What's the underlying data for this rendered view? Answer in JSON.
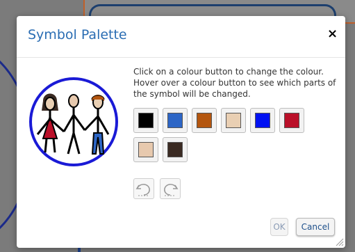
{
  "dialog": {
    "title": "Symbol Palette",
    "close_label": "×",
    "instructions": "Click on a colour button to change the colour. Hover over a colour button to see which parts of the symbol will be changed.",
    "ok_label": "OK",
    "cancel_label": "Cancel"
  },
  "colours": [
    {
      "name": "black",
      "hex": "#000000"
    },
    {
      "name": "mid-blue",
      "hex": "#2d66c6"
    },
    {
      "name": "brown-orange",
      "hex": "#b4560f"
    },
    {
      "name": "skin-light",
      "hex": "#e9cfb3"
    },
    {
      "name": "bright-blue",
      "hex": "#0011f2"
    },
    {
      "name": "crimson",
      "hex": "#ba1029"
    },
    {
      "name": "skin-tan",
      "hex": "#e7c9ae"
    },
    {
      "name": "dark-brown",
      "hex": "#3a2a22"
    }
  ],
  "tools": [
    "undo-icon",
    "redo-icon"
  ],
  "accent": "#2a6db3"
}
